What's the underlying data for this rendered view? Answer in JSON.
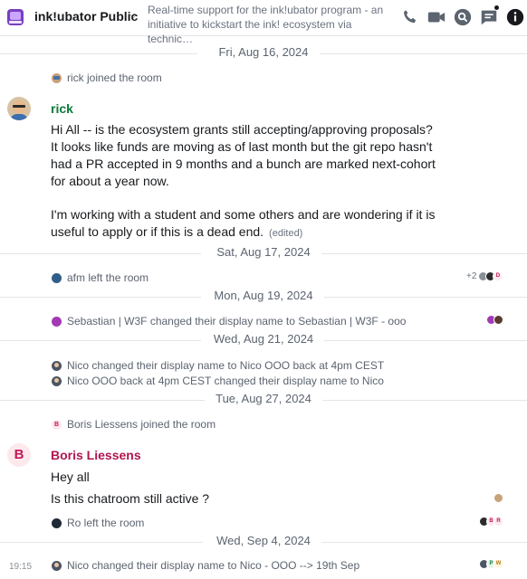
{
  "header": {
    "room_name": "ink!ubator Public",
    "topic": "Real-time support for the ink!ubator program - an initiative to kickstart the ink! ecosystem via technic…"
  },
  "timeline": {
    "date_fri": "Fri, Aug 16, 2024",
    "rick_joined": "rick joined the room",
    "rick": {
      "sender": "rick",
      "paragraph1": "Hi All -- is the ecosystem grants still accepting/approving proposals? It looks like funds are moving as of last month but the git repo hasn't had a PR accepted in 9 months and a bunch are marked next-cohort for about a year now.",
      "paragraph2": "I'm working with a student and some others and are wondering if it is useful to apply or if this is a dead end.",
      "edited": "(edited)"
    },
    "date_sat": "Sat, Aug 17, 2024",
    "afm_left": "afm left the room",
    "receipts_count": "+2",
    "date_mon": "Mon, Aug 19, 2024",
    "seb_changed": "Sebastian | W3F changed their display name to Sebastian | W3F - ooo",
    "date_wed": "Wed, Aug 21, 2024",
    "nico_changed_1": "Nico changed their display name to Nico OOO back at 4pm CEST",
    "nico_changed_2": "Nico OOO back at 4pm CEST changed their display name to Nico",
    "date_tue": "Tue, Aug 27, 2024",
    "boris_joined": "Boris Liessens joined the room",
    "boris": {
      "avatar_letter": "B",
      "sender": "Boris Liessens",
      "line1": "Hey all",
      "line2": "Is this chatroom still active ?"
    },
    "ro_left": "Ro left the room",
    "date_wed_sep": "Wed, Sep 4, 2024",
    "time_1915": "19:15",
    "nico_changed_3": "Nico changed their display name to Nico - OOO --> 19th Sep"
  },
  "receipt_letters": {
    "d": "D",
    "b": "B",
    "r": "R",
    "p": "P",
    "w": "W"
  },
  "colors": {
    "accent_green": "#0b7a3a",
    "accent_pink": "#b0164f",
    "room_avatar": "#7a3fbf"
  },
  "icons": {
    "room_menu": "chevron-down-icon",
    "voice_call": "phone-icon",
    "video_call": "video-icon",
    "search": "search-icon",
    "threads": "threads-icon",
    "room_info": "info-icon"
  }
}
